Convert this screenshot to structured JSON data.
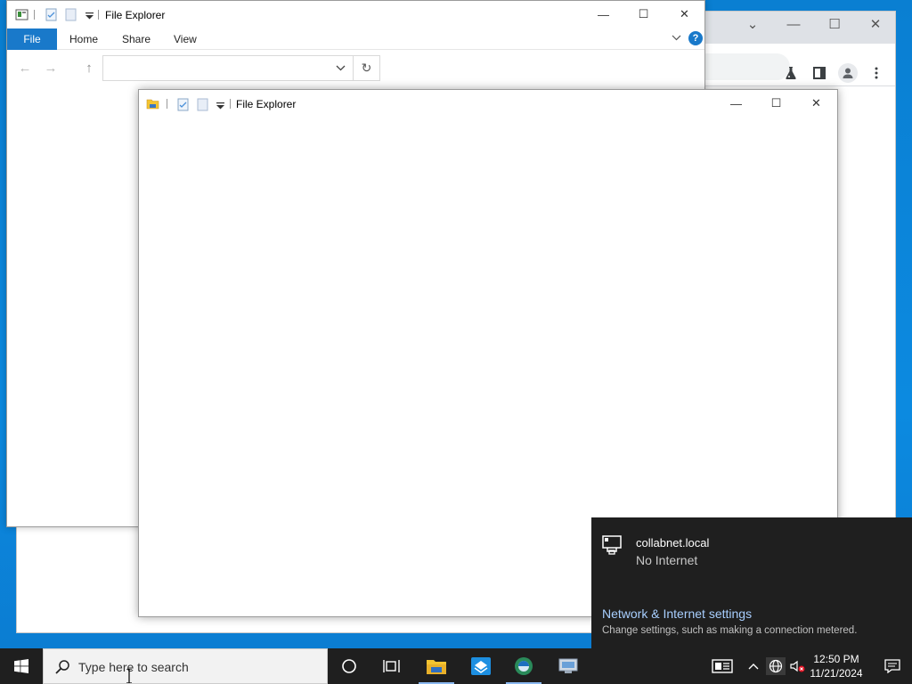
{
  "browser": {
    "controls": {
      "collapse": "⌄",
      "minimize": "—",
      "maximize": "☐",
      "close": "✕"
    }
  },
  "explorer_back": {
    "title": "File Explorer",
    "tabs": {
      "file": "File",
      "home": "Home",
      "share": "Share",
      "view": "View"
    },
    "help": "?",
    "address_value": "",
    "refresh": "↻",
    "controls": {
      "minimize": "—",
      "maximize": "☐",
      "close": "✕"
    }
  },
  "explorer_front": {
    "title": "File Explorer",
    "controls": {
      "minimize": "—",
      "maximize": "☐",
      "close": "✕"
    }
  },
  "network_flyout": {
    "network_name": "collabnet.local",
    "network_status": "No Internet",
    "settings_link": "Network & Internet settings",
    "settings_desc": "Change settings, such as making a connection metered."
  },
  "taskbar": {
    "search_placeholder": "Type here to search",
    "clock_time": "12:50 PM",
    "clock_date": "11/21/2024",
    "pinned": [
      "cortana-icon",
      "task-view-icon",
      "file-explorer-icon",
      "app-icon",
      "edge-icon",
      "remote-desktop-icon"
    ]
  },
  "colors": {
    "accent": "#1979ca",
    "desktop": "#0b80d4",
    "taskbar": "#1f1f1f",
    "link": "#a8cfff"
  }
}
